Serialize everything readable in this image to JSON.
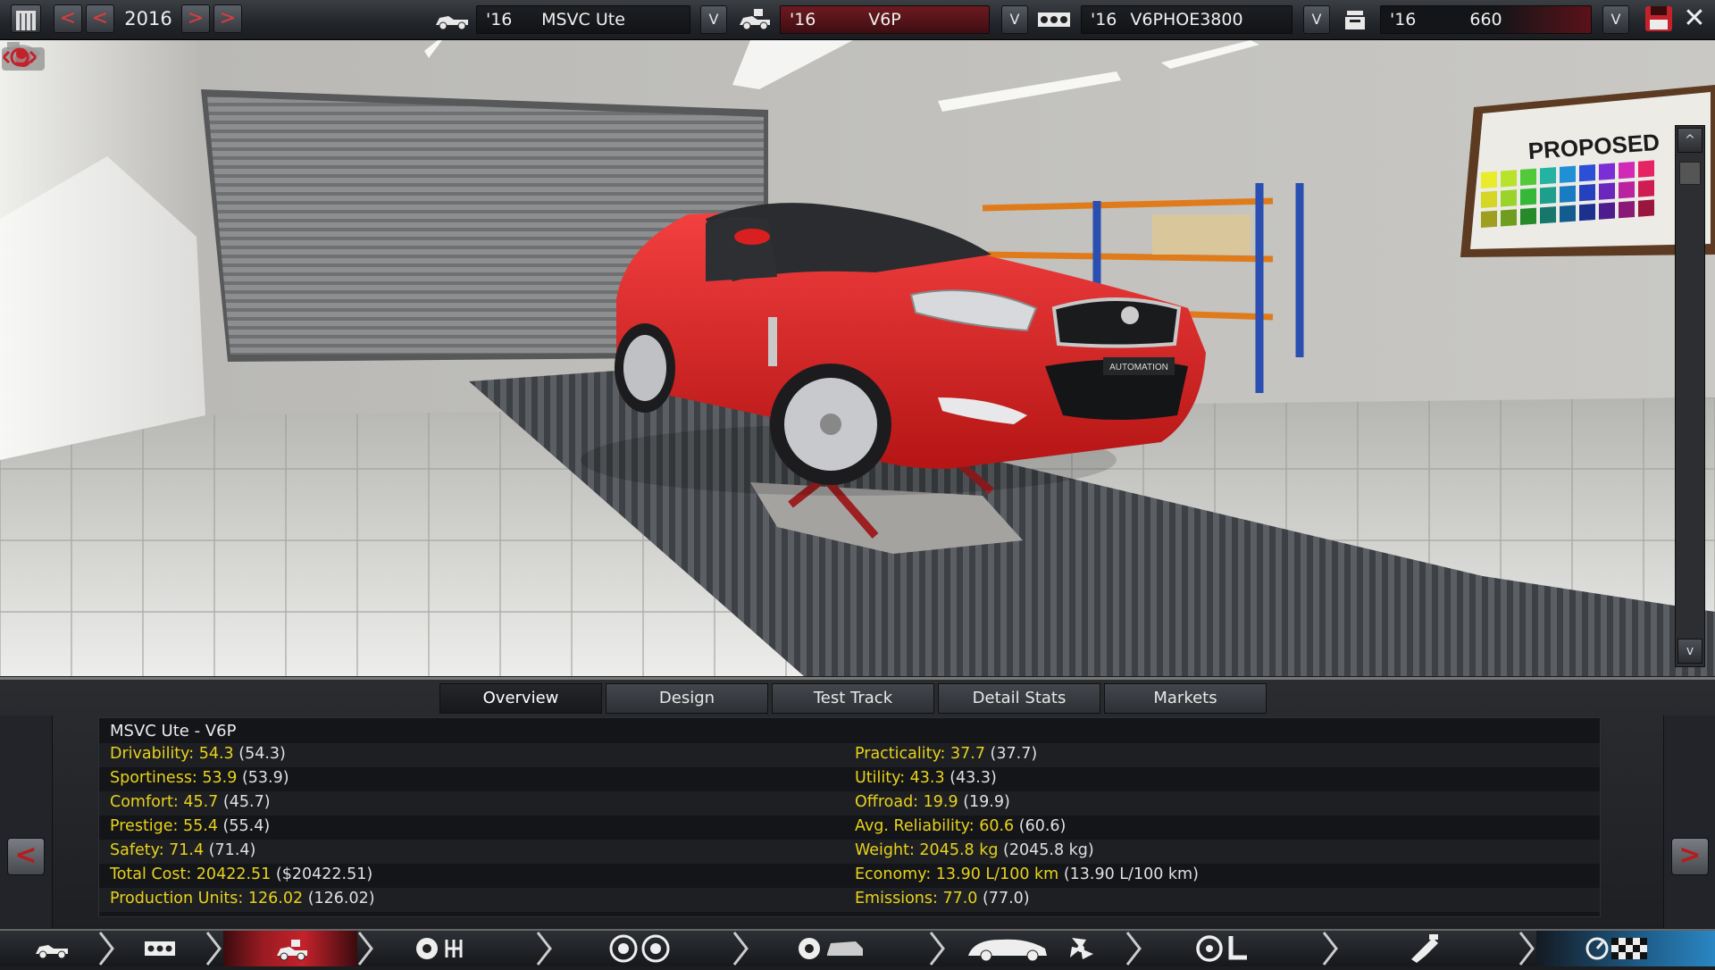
{
  "topbar": {
    "year": "2016",
    "calendar_icon": "calendar-icon",
    "prev_fast": "<",
    "prev": "<",
    "next": ">",
    "next_fast": ">",
    "dropdown_glyph": "V",
    "close_glyph": "✕",
    "selectors": [
      {
        "year": "'16",
        "name": "MSVC Ute",
        "icon": "ute-icon"
      },
      {
        "year": "'16",
        "name": "V6P",
        "icon": "car-variant-icon"
      },
      {
        "year": "'16",
        "name": "V6PHOE3800",
        "icon": "engine-icon"
      },
      {
        "year": "'16",
        "name": "660",
        "icon": "engine-variant-icon"
      }
    ],
    "colors": {
      "accent_red": "#c4222b",
      "selector_red": "#6e1a20"
    }
  },
  "scene": {
    "board_label": "PROPOSED",
    "car_badge": "AUTOMATION",
    "scroll_up": "^",
    "scroll_down": "v"
  },
  "tabs": [
    {
      "label": "Overview",
      "active": true
    },
    {
      "label": "Design",
      "active": false
    },
    {
      "label": "Test Track",
      "active": false
    },
    {
      "label": "Detail Stats",
      "active": false
    },
    {
      "label": "Markets",
      "active": false
    }
  ],
  "overview": {
    "title": "MSVC Ute - V6P",
    "left": [
      {
        "key": "Drivability: 54.3",
        "prev": "(54.3)"
      },
      {
        "key": "Sportiness: 53.9",
        "prev": "(53.9)"
      },
      {
        "key": "Comfort: 45.7",
        "prev": "(45.7)"
      },
      {
        "key": "Prestige: 55.4",
        "prev": "(55.4)"
      },
      {
        "key": "Safety: 71.4",
        "prev": "(71.4)"
      },
      {
        "key": "Total Cost: 20422.51",
        "prev": "($20422.51)"
      },
      {
        "key": "Production Units: 126.02",
        "prev": "(126.02)"
      }
    ],
    "right": [
      {
        "key": "Practicality: 37.7",
        "prev": "(37.7)"
      },
      {
        "key": "Utility: 43.3",
        "prev": "(43.3)"
      },
      {
        "key": "Offroad: 19.9",
        "prev": "(19.9)"
      },
      {
        "key": "Avg. Reliability: 60.6",
        "prev": "(60.6)"
      },
      {
        "key": "Weight: 2045.8 kg",
        "prev": "(2045.8 kg)"
      },
      {
        "key": "Economy: 13.90 L/100 km",
        "prev": "(13.90 L/100 km)"
      },
      {
        "key": "Emissions: 77.0",
        "prev": "(77.0)"
      }
    ],
    "prev_page": "<",
    "next_page": ">"
  },
  "bottom_nav": [
    {
      "name": "nav-car-model",
      "icon": "ute-icon"
    },
    {
      "name": "nav-engine",
      "icon": "engine-block-icon"
    },
    {
      "name": "nav-car-variant",
      "icon": "car-variant-icon",
      "active": true
    },
    {
      "name": "nav-drivetrain",
      "icon": "gearbox-icon"
    },
    {
      "name": "nav-suspension",
      "icon": "wheels-icon"
    },
    {
      "name": "nav-chassis-body",
      "icon": "body-icon"
    },
    {
      "name": "nav-aero",
      "icon": "aero-fan-icon"
    },
    {
      "name": "nav-interior",
      "icon": "steering-seat-icon"
    },
    {
      "name": "nav-fuel-system",
      "icon": "fuel-injector-icon"
    },
    {
      "name": "nav-testing",
      "icon": "gauge-flag-icon"
    }
  ]
}
